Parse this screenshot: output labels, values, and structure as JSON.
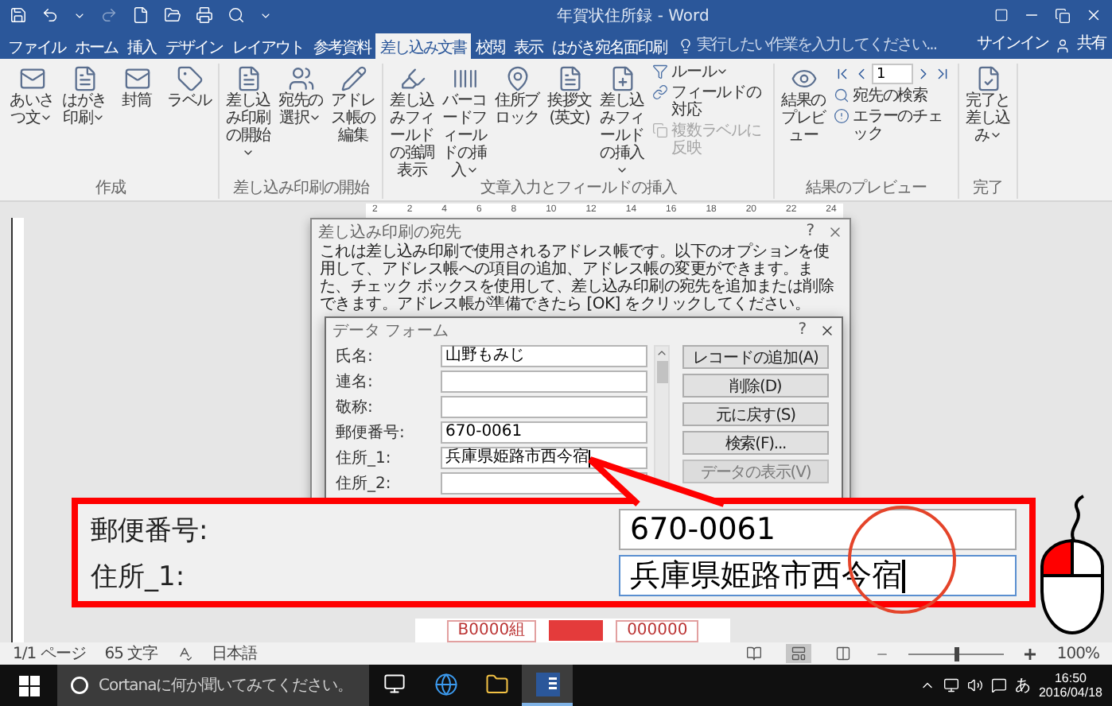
{
  "window": {
    "title": "年賀状住所録 - Word"
  },
  "tabs": [
    {
      "label": "ファイル",
      "selected": false
    },
    {
      "label": "ホーム",
      "selected": false
    },
    {
      "label": "挿入",
      "selected": false
    },
    {
      "label": "デザイン",
      "selected": false
    },
    {
      "label": "レイアウト",
      "selected": false
    },
    {
      "label": "参考資料",
      "selected": false
    },
    {
      "label": "差し込み文書",
      "selected": true
    },
    {
      "label": "校閲",
      "selected": false
    },
    {
      "label": "表示",
      "selected": false
    },
    {
      "label": "はがき宛名面印刷",
      "selected": false
    }
  ],
  "tell_me": {
    "placeholder": "実行したい作業を入力してください..."
  },
  "account": {
    "sign_in": "サインイン",
    "share": "共有"
  },
  "ribbon": [
    {
      "label": "作成",
      "items": [
        {
          "kind": "large",
          "label": "あいさつ文",
          "dropdown": true
        },
        {
          "kind": "large",
          "label": "はがき印刷",
          "dropdown": true
        },
        {
          "kind": "large",
          "label": "封筒",
          "dropdown": false
        },
        {
          "kind": "large",
          "label": "ラベル",
          "dropdown": false
        }
      ]
    },
    {
      "label": "差し込み印刷の開始",
      "items": [
        {
          "kind": "large",
          "label": "差し込み印刷の開始",
          "dropdown": true
        },
        {
          "kind": "large",
          "label": "宛先の選択",
          "dropdown": true
        },
        {
          "kind": "large",
          "label": "アドレス帳の編集",
          "dropdown": false
        }
      ]
    },
    {
      "label": "文章入力とフィールドの挿入",
      "items": [
        {
          "kind": "large",
          "label": "差し込みフィールドの強調表示",
          "dropdown": false
        },
        {
          "kind": "large",
          "label": "バーコードフィールドの挿入",
          "dropdown": true
        },
        {
          "kind": "large",
          "label": "住所ブロック",
          "dropdown": false
        },
        {
          "kind": "large",
          "label": "挨拶文(英文)",
          "dropdown": false
        },
        {
          "kind": "large",
          "label": "差し込みフィールドの挿入",
          "dropdown": true
        },
        {
          "kind": "small",
          "label": "ルール",
          "dropdown": true,
          "disabled": false
        },
        {
          "kind": "small",
          "label": "フィールドの対応",
          "dropdown": false,
          "disabled": false
        },
        {
          "kind": "small",
          "label": "複数ラベルに反映",
          "dropdown": false,
          "disabled": true
        }
      ]
    },
    {
      "label": "結果のプレビュー",
      "items": [
        {
          "kind": "large",
          "label": "結果のプレビュー",
          "dropdown": false
        },
        {
          "kind": "nav",
          "record": "1"
        },
        {
          "kind": "small",
          "label": "宛先の検索",
          "dropdown": false,
          "disabled": false
        },
        {
          "kind": "small",
          "label": "エラーのチェック",
          "dropdown": false,
          "disabled": false
        }
      ]
    },
    {
      "label": "完了",
      "items": [
        {
          "kind": "large",
          "label": "完了と差し込み",
          "dropdown": true
        }
      ]
    }
  ],
  "ruler": {
    "ticks": [
      "2",
      "2",
      "4",
      "6",
      "8",
      "10",
      "12",
      "14",
      "16",
      "18",
      "20",
      "22",
      "24"
    ]
  },
  "merge_dialog": {
    "title": "差し込み印刷の宛先",
    "help": "?",
    "description": "これは差し込み印刷で使用されるアドレス帳です。以下のオプションを使用して、アドレス帳への項目の追加、アドレス帳の変更ができます。また、チェック ボックスを使用して、差し込み印刷の宛先を追加または削除できます。アドレス帳が準備できたら [OK] をクリックしてください。"
  },
  "data_form": {
    "title": "データ フォーム",
    "help": "?",
    "fields": [
      {
        "label": "氏名:",
        "value": "山野もみじ",
        "focused": false
      },
      {
        "label": "連名:",
        "focused": false
      },
      {
        "label": "敬称:",
        "focused": false
      },
      {
        "label": "郵便番号:",
        "value": "670-0061",
        "focused": false
      },
      {
        "label": "住所_1:",
        "value": "兵庫県姫路市西今宿",
        "focused": true
      },
      {
        "label": "住所_2:",
        "focused": false
      }
    ],
    "buttons": [
      {
        "label": "レコードの追加(A)",
        "disabled": false
      },
      {
        "label": "削除(D)",
        "disabled": false
      },
      {
        "label": "元に戻す(S)",
        "disabled": false
      },
      {
        "label": "検索(F)...",
        "disabled": false
      },
      {
        "label": "データの表示(V)",
        "disabled": true
      }
    ]
  },
  "callout": {
    "rows": [
      {
        "label": "郵便番号:",
        "value": "670-0061",
        "focused": false
      },
      {
        "label": "住所_1:",
        "value": "兵庫県姫路市西今宿",
        "focused": true
      }
    ]
  },
  "page": {
    "group_code": "B0000組",
    "number": "000000"
  },
  "status_bar": {
    "page": "1/1 ページ",
    "words": "65 文字",
    "language": "日本語",
    "views": [
      {
        "selected": false
      },
      {
        "selected": true
      },
      {
        "selected": false
      }
    ],
    "zoom": {
      "level": 0.5,
      "reading": "100%"
    }
  },
  "taskbar": {
    "search": {
      "placeholder": "Cortanaに何か聞いてみてください。"
    },
    "apps": [
      {
        "kind": "task-view",
        "active": false
      },
      {
        "kind": "browser",
        "active": false
      },
      {
        "kind": "folder",
        "active": false
      },
      {
        "kind": "word",
        "active": true
      }
    ],
    "ime": "あ",
    "time": "16:50",
    "date": "2016/04/18"
  }
}
